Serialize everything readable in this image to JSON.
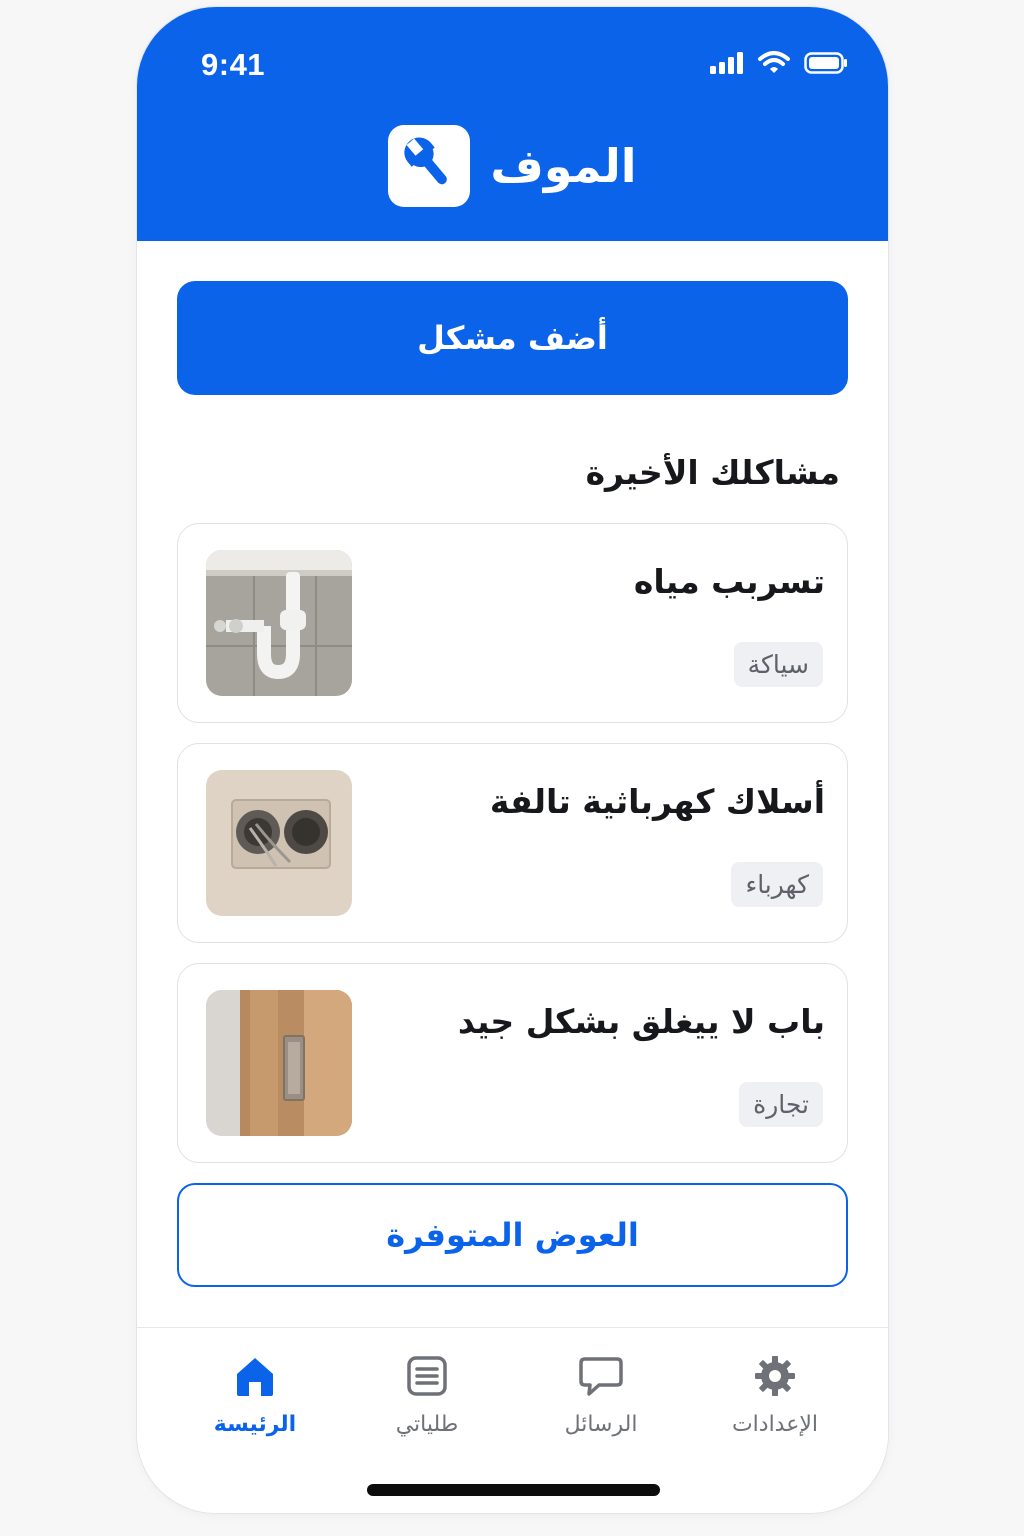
{
  "status_bar": {
    "time": "9:41",
    "icons": [
      "cellular-signal-icon",
      "wifi-icon",
      "battery-icon"
    ]
  },
  "header": {
    "app_name": "الموف",
    "logo_icon": "wrench-icon",
    "background": "#0b63ea"
  },
  "main": {
    "add_problem_label": "أضف مشكل",
    "recent_title": "مشاكلك الأخيرة",
    "problems": [
      {
        "title": "تسربب مياه",
        "tag": "سياكة",
        "thumbnail": "sink-pipe-image"
      },
      {
        "title": "أسلاك كهرباثية تالفة",
        "tag": "كهرباء",
        "thumbnail": "damaged-socket-image"
      },
      {
        "title": "باب لا ييغلق  بشكل جيد",
        "tag": "تجارة",
        "thumbnail": "door-hinge-image"
      }
    ],
    "offers_label": "العوض المتوفرة"
  },
  "nav": {
    "items": [
      {
        "label": "الرئيسة",
        "icon": "home-icon",
        "active": true
      },
      {
        "label": "طلياتي",
        "icon": "list-icon",
        "active": false
      },
      {
        "label": "الرسائل",
        "icon": "chat-icon",
        "active": false
      },
      {
        "label": "الإعدادات",
        "icon": "gear-icon",
        "active": false
      }
    ]
  },
  "colors": {
    "accent": "#0b63ea",
    "text": "#17181b",
    "muted": "#6e7178",
    "tag_bg": "#eef0f3"
  }
}
